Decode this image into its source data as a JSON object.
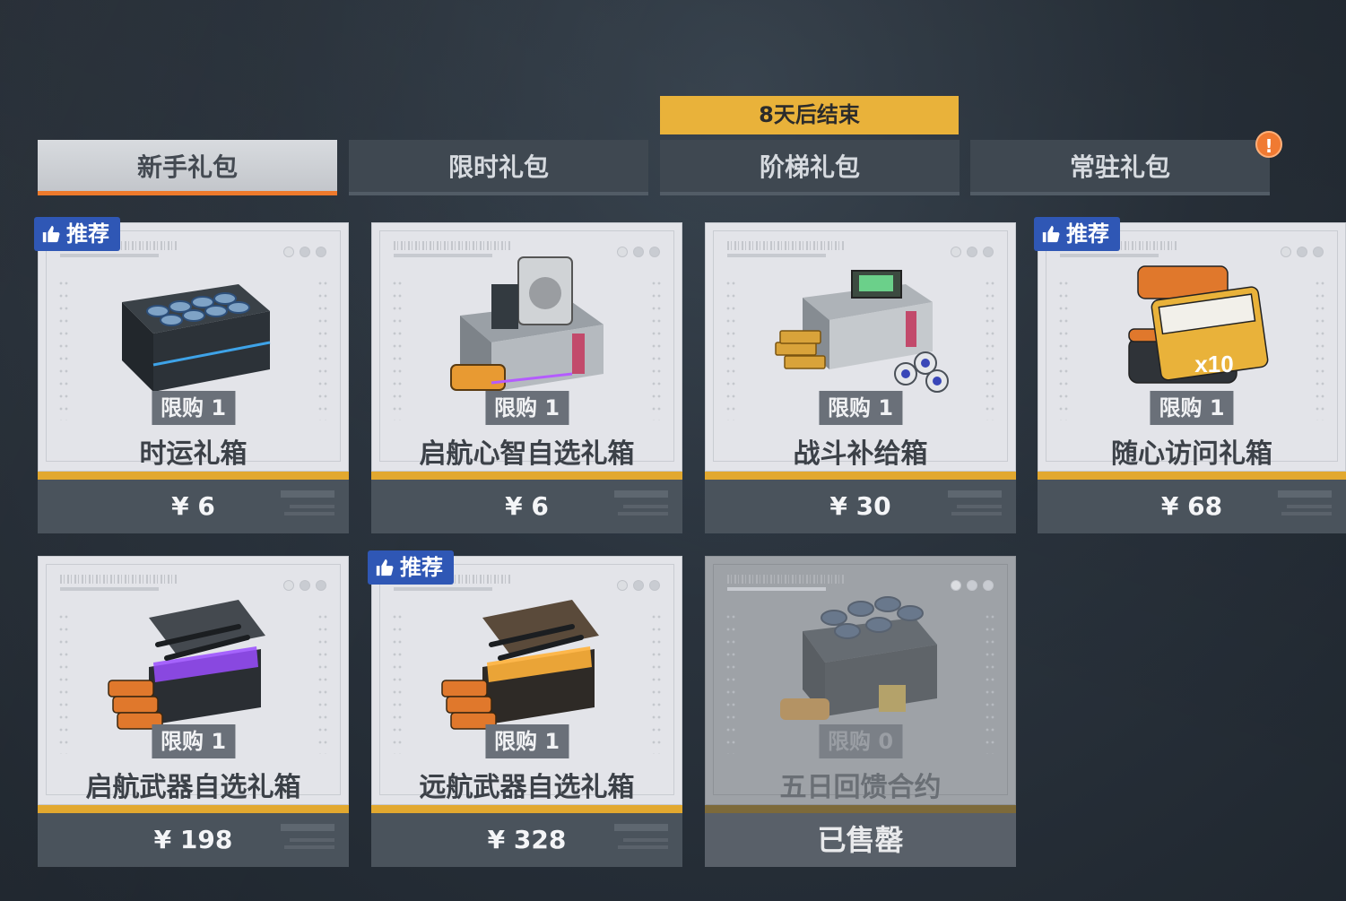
{
  "countdown": "8天后结束",
  "tabs": [
    {
      "label": "新手礼包",
      "active": true
    },
    {
      "label": "限时礼包",
      "active": false
    },
    {
      "label": "阶梯礼包",
      "active": false
    },
    {
      "label": "常驻礼包",
      "active": false,
      "alert": "!"
    }
  ],
  "badge_label": "推荐",
  "cards": [
    {
      "limit": "限购 1",
      "name": "时运礼箱",
      "price": "¥ 6",
      "recommended": true,
      "art": "coin-crate-icon"
    },
    {
      "limit": "限购 1",
      "name": "启航心智自选礼箱",
      "price": "¥ 6",
      "recommended": false,
      "art": "module-case-icon"
    },
    {
      "limit": "限购 1",
      "name": "战斗补给箱",
      "price": "¥ 30",
      "recommended": false,
      "art": "supply-crate-icon"
    },
    {
      "limit": "限购 1",
      "name": "随心访问礼箱",
      "price": "¥ 68",
      "recommended": true,
      "art": "pass-stack-icon"
    },
    {
      "limit": "限购 1",
      "name": "启航武器自选礼箱",
      "price": "¥ 198",
      "recommended": false,
      "art": "purple-weapon-chest-icon"
    },
    {
      "limit": "限购 1",
      "name": "远航武器自选礼箱",
      "price": "¥ 328",
      "recommended": true,
      "art": "gold-weapon-chest-icon"
    },
    {
      "limit": "限购 0",
      "name": "五日回馈合约",
      "price": "已售罄",
      "recommended": false,
      "soldout": true,
      "art": "coin-crate-icon"
    }
  ],
  "colors": {
    "accent_orange": "#ee7a2c",
    "gold": "#e2a82f",
    "countdown_bg": "#e9b23a",
    "badge_blue": "#2f57b5",
    "price_bar": "#4a535c"
  }
}
